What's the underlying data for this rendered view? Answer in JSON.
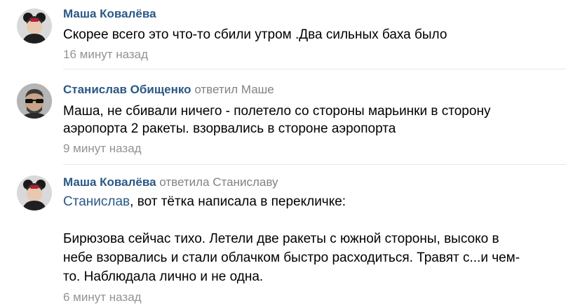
{
  "comments": [
    {
      "author": "Маша Ковалёва",
      "text": "Скорее всего это что-то сбили утром .Два сильных баха было",
      "date": "16 минут назад"
    },
    {
      "author": "Станислав Обищенко",
      "reply_word": "ответил",
      "reply_to": "Маше",
      "text_line1": "Маша, не сбивали ничего - полетело со стороны марьинки в сторону",
      "text_line2": "аэропорта 2 ракеты. взорвались в стороне аэропорта",
      "date": "9 минут назад"
    },
    {
      "author": "Маша Ковалёва",
      "reply_word": "ответила",
      "reply_to": "Станиславу",
      "mention": "Станислав",
      "text_line1_rest": ", вот тётка написала в перекличке:",
      "quote_line1": "Бирюзова сейчас тихо. Летели две ракеты с южной стороны, высоко в",
      "quote_line2": "небе взорвались и стали облачком быстро расходиться. Травят с...и чем-",
      "quote_line3": "то. Наблюдала лично и не одна.",
      "date": "6 минут назад"
    }
  ],
  "colors": {
    "link": "#2a5885",
    "muted": "#828282",
    "date": "#939393",
    "divider": "#e7e8ec"
  },
  "icons": {
    "avatar_masha": "avatar-photo-girl-mickey-ears",
    "avatar_stanislav": "avatar-photo-man-sunglasses"
  }
}
